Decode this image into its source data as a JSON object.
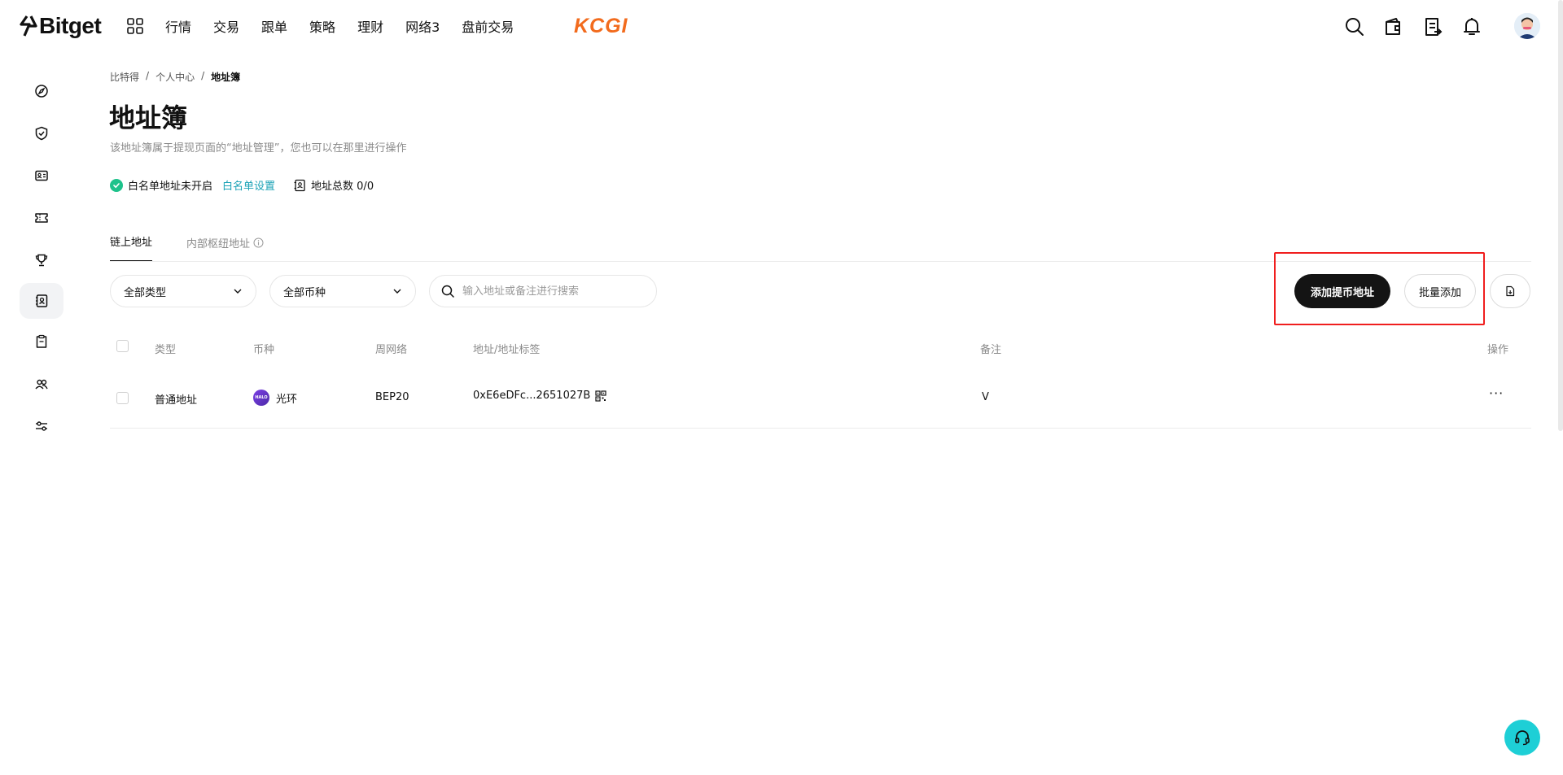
{
  "brand": {
    "name": "Bitget",
    "partner_logo": "KCGI"
  },
  "nav": {
    "items": [
      "行情",
      "交易",
      "跟单",
      "策略",
      "理财",
      "网络3",
      "盘前交易"
    ]
  },
  "header_icons": [
    "search-icon",
    "wallet-icon",
    "orders-icon",
    "bell-icon",
    "user-avatar"
  ],
  "sidebar": {
    "icons": [
      "compass-icon",
      "shield-check-icon",
      "id-card-icon",
      "ticket-icon",
      "trophy-icon",
      "address-book-icon",
      "clipboard-icon",
      "users-icon",
      "settings-sliders-icon"
    ],
    "active_index": 5
  },
  "breadcrumb": {
    "items": [
      "比特得",
      "个人中心",
      "地址簿"
    ],
    "separator": "/"
  },
  "page": {
    "title": "地址簿",
    "subtitle": "该地址簿属于提现页面的“地址管理”，您也可以在那里进行操作"
  },
  "status": {
    "whitelist_text": "白名单地址未开启",
    "whitelist_link": "白名单设置",
    "total_label": "地址总数 0/0"
  },
  "tabs": [
    {
      "label": "链上地址",
      "active": true
    },
    {
      "label": "内部枢纽地址",
      "active": false
    }
  ],
  "filters": {
    "type_select": "全部类型",
    "coin_select": "全部币种",
    "search_placeholder": "输入地址或备注进行搜索"
  },
  "actions": {
    "add_label": "添加提币地址",
    "batch_label": "批量添加"
  },
  "table": {
    "headers": [
      "类型",
      "币种",
      "周网络",
      "地址/地址标签",
      "备注",
      "操作"
    ],
    "rows": [
      {
        "type": "普通地址",
        "coin": "光环",
        "coin_logo_text": "HALO",
        "network": "BEP20",
        "address": "0xE6eDFc...2651027B",
        "remark": "V",
        "menu": "···"
      }
    ]
  },
  "colors": {
    "accent_teal": "#1ba2b6",
    "success_green": "#1ec28b",
    "highlight_red": "#f01e1e",
    "kcgi_orange": "#f26b1d",
    "support_cyan": "#1ecfd6"
  }
}
